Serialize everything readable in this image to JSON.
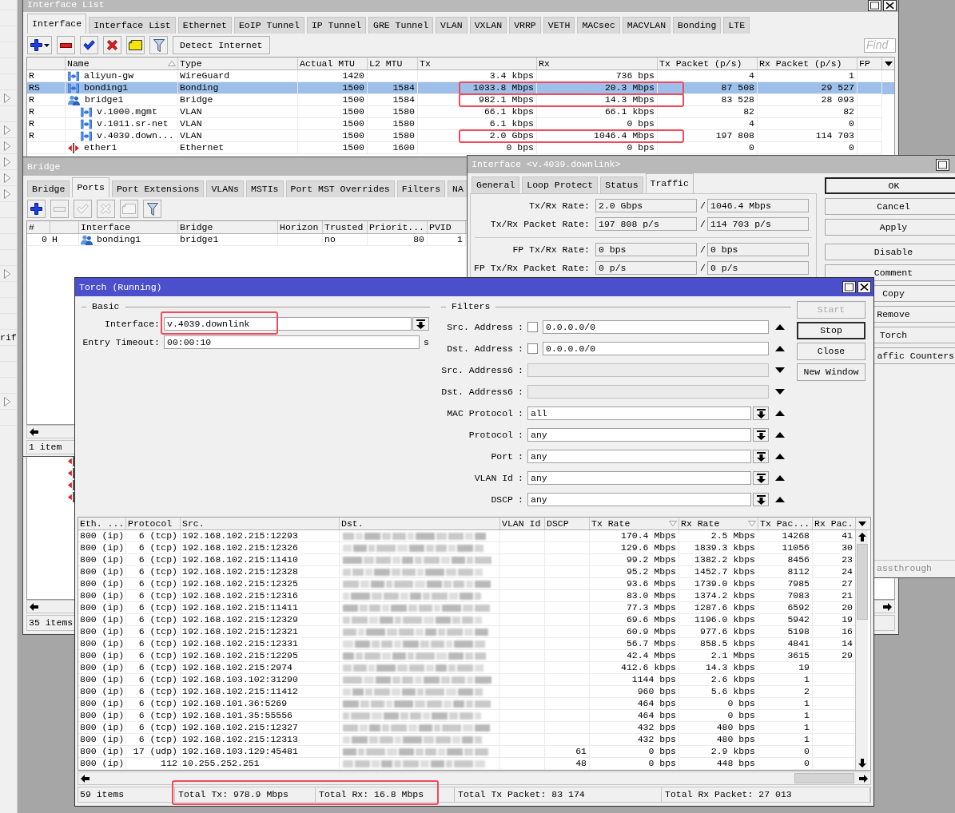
{
  "left_menu": {
    "items": [
      {
        "submenu": false
      },
      {
        "submenu": false
      },
      {
        "submenu": false
      },
      {
        "submenu": false
      },
      {
        "submenu": false
      },
      {
        "submenu": false
      },
      {
        "submenu": true
      },
      {
        "submenu": false
      },
      {
        "submenu": true
      },
      {
        "submenu": true
      },
      {
        "submenu": true
      },
      {
        "submenu": true
      },
      {
        "submenu": true
      },
      {
        "submenu": false
      },
      {
        "submenu": false
      },
      {
        "submenu": false
      },
      {
        "submenu": false
      },
      {
        "submenu": true
      },
      {
        "submenu": false
      },
      {
        "submenu": false
      },
      {
        "submenu": false
      },
      {
        "label": "rif",
        "submenu": false
      },
      {
        "submenu": false
      },
      {
        "submenu": false
      },
      {
        "submenu": false
      },
      {
        "submenu": true
      },
      {
        "submenu": false
      }
    ]
  },
  "interface_list": {
    "title": "Interface List",
    "tabs": [
      {
        "label": "Interface",
        "selected": true
      },
      {
        "label": "Interface List",
        "selected": false
      },
      {
        "label": "Ethernet",
        "selected": false
      },
      {
        "label": "EoIP Tunnel",
        "selected": false
      },
      {
        "label": "IP Tunnel",
        "selected": false
      },
      {
        "label": "GRE Tunnel",
        "selected": false
      },
      {
        "label": "VLAN",
        "selected": false
      },
      {
        "label": "VXLAN",
        "selected": false
      },
      {
        "label": "VRRP",
        "selected": false
      },
      {
        "label": "VETH",
        "selected": false
      },
      {
        "label": "MACsec",
        "selected": false
      },
      {
        "label": "MACVLAN",
        "selected": false
      },
      {
        "label": "Bonding",
        "selected": false
      },
      {
        "label": "LTE",
        "selected": false
      }
    ],
    "toolbar": [
      {
        "kind": "add_menu",
        "disabled": false
      },
      {
        "kind": "remove",
        "disabled": false
      },
      {
        "kind": "enable",
        "disabled": false
      },
      {
        "kind": "disable",
        "disabled": false
      },
      {
        "kind": "comment",
        "disabled": false
      },
      {
        "kind": "filter",
        "disabled": false
      },
      {
        "kind": "text",
        "label": "Detect Internet",
        "disabled": false
      }
    ],
    "search": {
      "placeholder": "Find"
    },
    "columns": [
      {
        "label": "Name",
        "sorted": true,
        "descending": false
      },
      {
        "label": "Type",
        "sorted": false
      },
      {
        "label": "Actual MTU",
        "sorted": false
      },
      {
        "label": "L2 MTU",
        "sorted": false
      },
      {
        "label": "Tx",
        "sorted": false
      },
      {
        "label": "Rx",
        "sorted": false
      },
      {
        "label": "Tx Packet (p/s)",
        "sorted": false
      },
      {
        "label": "Rx Packet (p/s)",
        "sorted": false
      },
      {
        "label": "FP",
        "sorted": false
      }
    ],
    "rows": [
      {
        "flags": "R",
        "name": "aliyun-gw",
        "type": "WireGuard",
        "actual_mtu": "1420",
        "tx": "3.4 kbps",
        "rx": "736 bps",
        "tx_packet": "4",
        "rx_packet": "1",
        "kind": "virtual",
        "selected": false
      },
      {
        "flags": "RS",
        "name": "bonding1",
        "type": "Bonding",
        "actual_mtu": "1500",
        "l2_mtu": "1584",
        "tx": "1033.8 Mbps",
        "rx": "20.3 Mbps",
        "tx_packet": "87 508",
        "rx_packet": "29 527",
        "kind": "virtual",
        "selected": true,
        "highlighted": true
      },
      {
        "flags": "R",
        "name": "bridge1",
        "type": "Bridge",
        "actual_mtu": "1500",
        "l2_mtu": "1584",
        "tx": "982.1 Mbps",
        "rx": "14.3 Mbps",
        "tx_packet": "83 528",
        "rx_packet": "28 093",
        "kind": "bridge",
        "selected": false,
        "highlighted": true,
        "children": [
          {
            "flags": "R",
            "name": "v.1000.mgmt",
            "type": "VLAN",
            "actual_mtu": "1500",
            "l2_mtu": "1580",
            "tx": "66.1 kbps",
            "rx": "66.1 kbps",
            "tx_packet": "82",
            "rx_packet": "82",
            "kind": "virtual",
            "selected": false
          },
          {
            "flags": "R",
            "name": "v.1011.sr-net",
            "type": "VLAN",
            "actual_mtu": "1500",
            "l2_mtu": "1580",
            "tx": "6.1 kbps",
            "rx": "0 bps",
            "tx_packet": "4",
            "rx_packet": "0",
            "kind": "virtual",
            "selected": false
          },
          {
            "flags": "R",
            "name": "v.4039.down...",
            "type": "VLAN",
            "actual_mtu": "1500",
            "l2_mtu": "1580",
            "tx": "2.0 Gbps",
            "rx": "1046.4 Mbps",
            "tx_packet": "197 808",
            "rx_packet": "114 703",
            "kind": "virtual",
            "selected": false,
            "highlighted": true
          }
        ]
      },
      {
        "name": "ether1",
        "type": "Ethernet",
        "actual_mtu": "1500",
        "l2_mtu": "1600",
        "tx": "0 bps",
        "rx": "0 bps",
        "tx_packet": "0",
        "rx_packet": "0",
        "kind": "ethernet",
        "selected": false
      }
    ],
    "covered_rows": [
      {
        "kind": "ethernet"
      },
      {
        "kind": "ethernet"
      },
      {
        "kind": "ethernet"
      },
      {
        "kind": "ethernet"
      }
    ],
    "status": "35 items"
  },
  "bridge": {
    "title": "Bridge",
    "tabs": [
      {
        "label": "Bridge",
        "selected": false
      },
      {
        "label": "Ports",
        "selected": true
      },
      {
        "label": "Port Extensions",
        "selected": false
      },
      {
        "label": "VLANs",
        "selected": false
      },
      {
        "label": "MSTIs",
        "selected": false
      },
      {
        "label": "Port MST Overrides",
        "selected": false
      },
      {
        "label": "Filters",
        "selected": false
      },
      {
        "label": "NA",
        "selected": false
      }
    ],
    "toolbar": [
      {
        "kind": "add",
        "disabled": false
      },
      {
        "kind": "remove",
        "disabled": true
      },
      {
        "kind": "enable",
        "disabled": true
      },
      {
        "kind": "disable",
        "disabled": true
      },
      {
        "kind": "comment",
        "disabled": true
      },
      {
        "kind": "filter",
        "disabled": false
      }
    ],
    "columns": [
      {
        "label": "#",
        "sorted": false
      },
      {
        "label": "Interface",
        "sorted": false
      },
      {
        "label": "Bridge",
        "sorted": false
      },
      {
        "label": "Horizon",
        "sorted": false
      },
      {
        "label": "Trusted",
        "sorted": false
      },
      {
        "label": "Priorit...",
        "sorted": false
      },
      {
        "label": "PVID",
        "sorted": false
      }
    ],
    "rows": [
      {
        "number": "0",
        "flags": "H",
        "interface": "bonding1",
        "bridge": "bridge1",
        "trusted": "no",
        "priority": "80",
        "pvid": "1",
        "kind": "bridge",
        "selected": false
      }
    ],
    "status": "1 item"
  },
  "interface_dialog": {
    "title": "Interface <v.4039.downlink>",
    "tabs": [
      {
        "label": "General",
        "selected": false
      },
      {
        "label": "Loop Protect",
        "selected": false
      },
      {
        "label": "Status",
        "selected": false
      },
      {
        "label": "Traffic",
        "selected": true
      }
    ],
    "groups": [
      [
        {
          "label": "Tx/Rx Rate:",
          "values": [
            "2.0 Gbps",
            "1046.4 Mbps"
          ],
          "separator": "/"
        },
        {
          "label": "Tx/Rx Packet Rate:",
          "values": [
            "197 808 p/s",
            "114 703 p/s"
          ],
          "separator": "/"
        }
      ],
      [
        {
          "label": "FP Tx/Rx Rate:",
          "values": [
            "0 bps",
            "0 bps"
          ],
          "separator": "/"
        },
        {
          "label": "FP Tx/Rx Packet Rate:",
          "values": [
            "0 p/s",
            "0 p/s"
          ],
          "separator": "/"
        }
      ]
    ],
    "button_groups": [
      [
        {
          "label": "OK",
          "default": true,
          "cut_off": false
        },
        {
          "label": "Cancel",
          "default": false,
          "cut_off": false
        },
        {
          "label": "Apply",
          "default": false,
          "cut_off": false
        }
      ],
      [
        {
          "label": "Disable",
          "default": false,
          "cut_off": false
        },
        {
          "label": "Comment",
          "default": false,
          "cut_off": false
        },
        {
          "label": "Copy",
          "default": false,
          "cut_off": false
        },
        {
          "label": "Remove",
          "default": false,
          "cut_off": false
        },
        {
          "label": "Torch",
          "default": false,
          "cut_off": false
        },
        {
          "label": "affic Counters",
          "default": false,
          "cut_off": true
        }
      ]
    ],
    "status": "assthrough"
  },
  "torch": {
    "title": "Torch (Running)",
    "basic": {
      "heading": "Basic",
      "fields": [
        {
          "kind": "select",
          "label": "Interface:",
          "value": "v.4039.downlink",
          "highlighted": true
        },
        {
          "kind": "text",
          "label": "Entry Timeout:",
          "value": "00:00:10",
          "unit": "s"
        }
      ]
    },
    "filters": {
      "heading": "Filters",
      "rows": [
        {
          "kind": "address",
          "label": "Src. Address",
          "separator": ":",
          "checked": false,
          "value": "0.0.0.0/0",
          "enabled": true
        },
        {
          "kind": "address",
          "label": "Dst. Address",
          "separator": ":",
          "checked": false,
          "value": "0.0.0.0/0",
          "enabled": true
        },
        {
          "kind": "text",
          "label": "Src. Address6",
          "separator": ":",
          "enabled": false
        },
        {
          "kind": "text",
          "label": "Dst. Address6",
          "separator": ":",
          "enabled": false
        },
        {
          "kind": "select",
          "label": "MAC Protocol",
          "separator": ":",
          "value": "all",
          "enabled": true
        },
        {
          "kind": "select",
          "label": "Protocol",
          "separator": ":",
          "value": "any",
          "enabled": true
        },
        {
          "kind": "select",
          "label": "Port",
          "separator": ":",
          "value": "any",
          "enabled": true
        },
        {
          "kind": "select",
          "label": "VLAN Id",
          "separator": ":",
          "value": "any",
          "enabled": true
        },
        {
          "kind": "select",
          "label": "DSCP",
          "separator": ":",
          "value": "any",
          "enabled": true
        }
      ]
    },
    "buttons": [
      {
        "label": "Start",
        "disabled": true,
        "default": false
      },
      {
        "label": "Stop",
        "disabled": false,
        "default": true
      },
      {
        "label": "Close",
        "disabled": false,
        "default": false
      },
      {
        "label": "New Window",
        "disabled": false,
        "default": false
      }
    ],
    "table": {
      "columns": [
        {
          "label": "Eth. ...",
          "sorted": false
        },
        {
          "label": "Protocol",
          "sorted": false
        },
        {
          "label": "Src.",
          "sorted": false
        },
        {
          "label": "Dst.",
          "sorted": false
        },
        {
          "label": "VLAN Id",
          "sorted": false
        },
        {
          "label": "DSCP",
          "sorted": false
        },
        {
          "label": "Tx Rate",
          "sorted": true,
          "descending": true
        },
        {
          "label": "Rx Rate",
          "sorted": true,
          "descending": true
        },
        {
          "label": "Tx Pac...",
          "sorted": false
        },
        {
          "label": "Rx Pac.",
          "sorted": false
        }
      ],
      "rows": [
        {
          "eth": "800 (ip)",
          "protocol": "6 (tcp)",
          "src": "192.168.102.215:12293",
          "dst_redacted": true,
          "tx_rate": "170.4 Mbps",
          "rx_rate": "2.5 Mbps",
          "tx_packets": "14268",
          "rx_packets": "41"
        },
        {
          "eth": "800 (ip)",
          "protocol": "6 (tcp)",
          "src": "192.168.102.215:12326",
          "dst_redacted": true,
          "tx_rate": "129.6 Mbps",
          "rx_rate": "1839.3 kbps",
          "tx_packets": "11056",
          "rx_packets": "30"
        },
        {
          "eth": "800 (ip)",
          "protocol": "6 (tcp)",
          "src": "192.168.102.215:11410",
          "dst_redacted": true,
          "tx_rate": "99.2 Mbps",
          "rx_rate": "1382.2 kbps",
          "tx_packets": "8456",
          "rx_packets": "23"
        },
        {
          "eth": "800 (ip)",
          "protocol": "6 (tcp)",
          "src": "192.168.102.215:12328",
          "dst_redacted": true,
          "tx_rate": "95.2 Mbps",
          "rx_rate": "1452.7 kbps",
          "tx_packets": "8112",
          "rx_packets": "24"
        },
        {
          "eth": "800 (ip)",
          "protocol": "6 (tcp)",
          "src": "192.168.102.215:12325",
          "dst_redacted": true,
          "tx_rate": "93.6 Mbps",
          "rx_rate": "1739.0 kbps",
          "tx_packets": "7985",
          "rx_packets": "27"
        },
        {
          "eth": "800 (ip)",
          "protocol": "6 (tcp)",
          "src": "192.168.102.215:12316",
          "dst_redacted": true,
          "tx_rate": "83.0 Mbps",
          "rx_rate": "1374.2 kbps",
          "tx_packets": "7083",
          "rx_packets": "21"
        },
        {
          "eth": "800 (ip)",
          "protocol": "6 (tcp)",
          "src": "192.168.102.215:11411",
          "dst_redacted": true,
          "tx_rate": "77.3 Mbps",
          "rx_rate": "1287.6 kbps",
          "tx_packets": "6592",
          "rx_packets": "20"
        },
        {
          "eth": "800 (ip)",
          "protocol": "6 (tcp)",
          "src": "192.168.102.215:12329",
          "dst_redacted": true,
          "tx_rate": "69.6 Mbps",
          "rx_rate": "1196.0 kbps",
          "tx_packets": "5942",
          "rx_packets": "19"
        },
        {
          "eth": "800 (ip)",
          "protocol": "6 (tcp)",
          "src": "192.168.102.215:12321",
          "dst_redacted": true,
          "tx_rate": "60.9 Mbps",
          "rx_rate": "977.6 kbps",
          "tx_packets": "5198",
          "rx_packets": "16"
        },
        {
          "eth": "800 (ip)",
          "protocol": "6 (tcp)",
          "src": "192.168.102.215:12331",
          "dst_redacted": true,
          "tx_rate": "56.7 Mbps",
          "rx_rate": "858.5 kbps",
          "tx_packets": "4841",
          "rx_packets": "14"
        },
        {
          "eth": "800 (ip)",
          "protocol": "6 (tcp)",
          "src": "192.168.102.215:12295",
          "dst_redacted": true,
          "tx_rate": "42.4 Mbps",
          "rx_rate": "2.1 Mbps",
          "tx_packets": "3615",
          "rx_packets": "29"
        },
        {
          "eth": "800 (ip)",
          "protocol": "6 (tcp)",
          "src": "192.168.102.215:2974",
          "dst_redacted": true,
          "tx_rate": "412.6 kbps",
          "rx_rate": "14.3 kbps",
          "tx_packets": "19"
        },
        {
          "eth": "800 (ip)",
          "protocol": "6 (tcp)",
          "src": "192.168.103.102:31290",
          "dst_redacted": true,
          "tx_rate": "1144 bps",
          "rx_rate": "2.6 kbps",
          "tx_packets": "1"
        },
        {
          "eth": "800 (ip)",
          "protocol": "6 (tcp)",
          "src": "192.168.102.215:11412",
          "dst_redacted": true,
          "tx_rate": "960 bps",
          "rx_rate": "5.6 kbps",
          "tx_packets": "2"
        },
        {
          "eth": "800 (ip)",
          "protocol": "6 (tcp)",
          "src": "192.168.101.36:5269",
          "dst_redacted": true,
          "tx_rate": "464 bps",
          "rx_rate": "0 bps",
          "tx_packets": "1"
        },
        {
          "eth": "800 (ip)",
          "protocol": "6 (tcp)",
          "src": "192.168.101.35:55556",
          "dst_redacted": true,
          "tx_rate": "464 bps",
          "rx_rate": "0 bps",
          "tx_packets": "1"
        },
        {
          "eth": "800 (ip)",
          "protocol": "6 (tcp)",
          "src": "192.168.102.215:12327",
          "dst_redacted": true,
          "tx_rate": "432 bps",
          "rx_rate": "480 bps",
          "tx_packets": "1"
        },
        {
          "eth": "800 (ip)",
          "protocol": "6 (tcp)",
          "src": "192.168.102.215:12313",
          "dst_redacted": true,
          "tx_rate": "432 bps",
          "rx_rate": "480 bps",
          "tx_packets": "1"
        },
        {
          "eth": "800 (ip)",
          "protocol": "17 (udp)",
          "src": "192.168.103.129:45481",
          "dst_redacted": true,
          "dscp": "61",
          "tx_rate": "0 bps",
          "rx_rate": "2.9 kbps",
          "tx_packets": "0"
        },
        {
          "eth": "800 (ip)",
          "protocol": "112",
          "src": "10.255.252.251",
          "dst_redacted": true,
          "dscp": "48",
          "tx_rate": "0 bps",
          "rx_rate": "448 bps",
          "tx_packets": "0"
        }
      ]
    },
    "status_bar": [
      {
        "text": "59 items"
      },
      {
        "text": "Total Tx: 978.9 Mbps",
        "highlighted": true
      },
      {
        "text": "Total Rx: 16.8 Mbps",
        "highlighted": true
      },
      {
        "text": "Total Tx Packet: 83 174"
      },
      {
        "text": "Total Rx Packet: 27 013"
      }
    ]
  }
}
